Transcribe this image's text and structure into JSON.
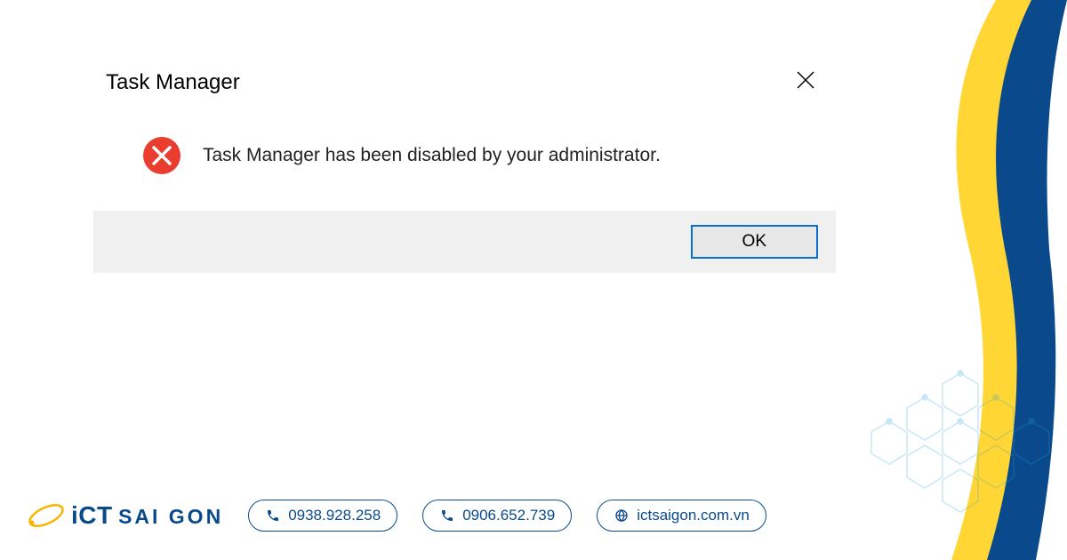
{
  "dialog": {
    "title": "Task Manager",
    "message": "Task Manager has been disabled by your administrator.",
    "ok_label": "OK"
  },
  "branding": {
    "logo_ict": "iCT",
    "logo_saigon": "SAI GON",
    "phone1": "0938.928.258",
    "phone2": "0906.652.739",
    "website": "ictsaigon.com.vn"
  },
  "colors": {
    "accent_blue": "#0a6fd1",
    "brand_blue": "#0a4a8c",
    "brand_yellow": "#f8b500",
    "error_red": "#e93e2f"
  }
}
